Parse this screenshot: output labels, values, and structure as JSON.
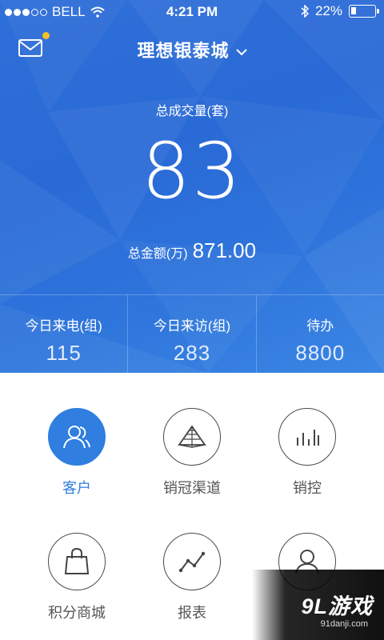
{
  "status_bar": {
    "carrier": "BELL",
    "time": "4:21 PM",
    "battery_percent": "22%",
    "battery_level": 0.22,
    "signal_bars_filled": 3,
    "signal_bars_total": 5,
    "icons": [
      "wifi-icon",
      "bluetooth-icon",
      "battery-icon"
    ]
  },
  "header": {
    "mail_icon": "mail-icon",
    "title": "理想银泰城",
    "chevron_icon": "chevron-down-icon"
  },
  "summary": {
    "total_label": "总成交量(套)",
    "total_value": "83",
    "amount_label": "总金额(万)",
    "amount_value": "871.00"
  },
  "stats": [
    {
      "label": "今日来电(组)",
      "value": "115"
    },
    {
      "label": "今日来访(组)",
      "value": "283"
    },
    {
      "label": "待办",
      "value": "8800"
    }
  ],
  "menu": [
    {
      "label": "客户",
      "icon": "customers-icon",
      "active": true
    },
    {
      "label": "销冠渠道",
      "icon": "pyramid-icon",
      "active": false
    },
    {
      "label": "销控",
      "icon": "bar-chart-icon",
      "active": false
    },
    {
      "label": "积分商城",
      "icon": "shopping-bag-icon",
      "active": false
    },
    {
      "label": "报表",
      "icon": "line-chart-icon",
      "active": false
    },
    {
      "label": "",
      "icon": "user-icon",
      "active": false
    }
  ],
  "watermark": {
    "main": "9L游戏",
    "sub": "91danji.com"
  },
  "colors": {
    "hero_blue": "#2f6fd8",
    "accent_blue": "#2f7ee0",
    "notification_dot": "#f5c02b"
  }
}
